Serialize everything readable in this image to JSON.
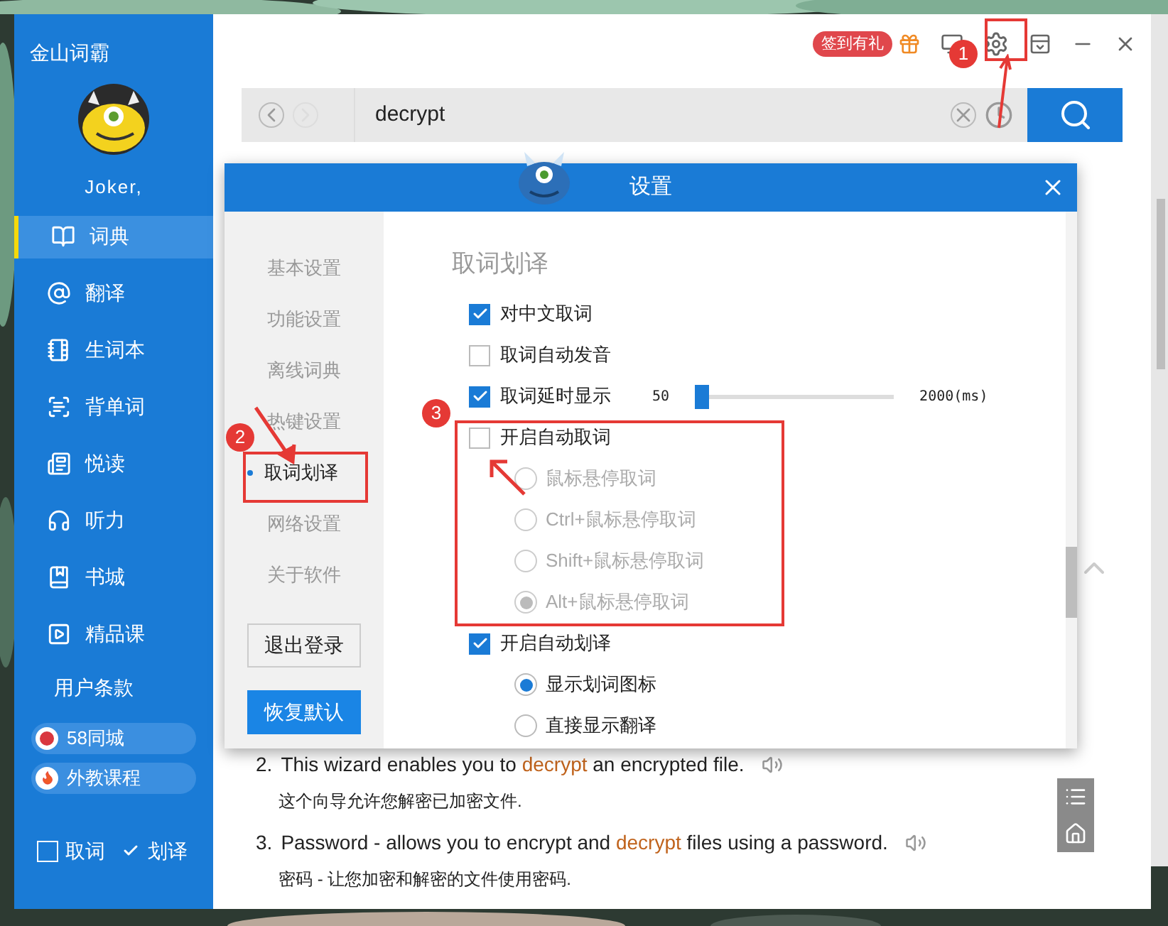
{
  "app": {
    "title": "金山词霸",
    "user": "Joker,"
  },
  "nav": [
    {
      "label": "词典",
      "kind": "dict",
      "selected": true
    },
    {
      "label": "翻译",
      "kind": "translate",
      "selected": false
    },
    {
      "label": "生词本",
      "kind": "notebook",
      "selected": false
    },
    {
      "label": "背单词",
      "kind": "ab",
      "selected": false
    },
    {
      "label": "悦读",
      "kind": "read",
      "selected": false
    },
    {
      "label": "听力",
      "kind": "listen",
      "selected": false
    },
    {
      "label": "书城",
      "kind": "book",
      "selected": false
    },
    {
      "label": "精品课",
      "kind": "play",
      "selected": false
    }
  ],
  "terms": "用户条款",
  "promos": [
    {
      "label": "58同城",
      "kind": "n"
    },
    {
      "label": "外教课程",
      "kind": "fire"
    }
  ],
  "toggles": [
    {
      "label": "取词",
      "checked": false
    },
    {
      "label": "划译",
      "checked": true
    }
  ],
  "topbar": {
    "badge": "签到有礼"
  },
  "search": {
    "value": "decrypt"
  },
  "dialog": {
    "title": "设置",
    "nav": [
      {
        "label": "基本设置",
        "selected": false
      },
      {
        "label": "功能设置",
        "selected": false
      },
      {
        "label": "离线词典",
        "selected": false
      },
      {
        "label": "热键设置",
        "selected": false
      },
      {
        "label": "取词划译",
        "selected": true
      },
      {
        "label": "网络设置",
        "selected": false
      },
      {
        "label": "关于软件",
        "selected": false
      }
    ],
    "buttons": [
      {
        "label": "退出登录",
        "kind": "outline"
      },
      {
        "label": "恢复默认",
        "kind": "primary"
      }
    ],
    "section_title": "取词划译",
    "options": [
      {
        "label": "对中文取词",
        "checked": true
      },
      {
        "label": "取词自动发音",
        "checked": false
      },
      {
        "label": "取词延时显示",
        "checked": true,
        "slider": {
          "min": "50",
          "max": "2000(ms)",
          "level": 0.0
        }
      },
      {
        "label": "开启自动取词",
        "checked": false,
        "radios_disabled": true,
        "radios": [
          {
            "label": "鼠标悬停取词",
            "selected": false
          },
          {
            "label": "Ctrl+鼠标悬停取词",
            "selected": false
          },
          {
            "label": "Shift+鼠标悬停取词",
            "selected": false
          },
          {
            "label": "Alt+鼠标悬停取词",
            "selected": true
          }
        ]
      },
      {
        "label": "开启自动划译",
        "checked": true,
        "radios_disabled": false,
        "radios": [
          {
            "label": "显示划词图标",
            "selected": true
          },
          {
            "label": "直接显示翻译",
            "selected": false
          }
        ]
      }
    ]
  },
  "results": [
    {
      "number": "2.",
      "text": "This wizard enables you to **decrypt** an encrypted file.",
      "translation": "这个向导允许您解密已加密文件."
    },
    {
      "number": "3.",
      "text": "Password - allows you to encrypt and **decrypt** files using a password.",
      "translation": "密码 - 让您加密和解密的文件使用密码."
    }
  ],
  "annotations": [
    "1",
    "2",
    "3"
  ]
}
